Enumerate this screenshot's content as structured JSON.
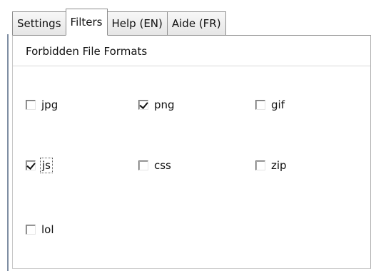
{
  "tabs": [
    {
      "label": "Settings",
      "active": false
    },
    {
      "label": "Filters",
      "active": true
    },
    {
      "label": "Help (EN)",
      "active": false
    },
    {
      "label": "Aide (FR)",
      "active": false
    }
  ],
  "filters": {
    "section_title": "Forbidden File Formats",
    "formats": [
      {
        "label": "jpg",
        "checked": false
      },
      {
        "label": "png",
        "checked": true
      },
      {
        "label": "gif",
        "checked": false
      },
      {
        "label": "js",
        "checked": true,
        "focused": true
      },
      {
        "label": "css",
        "checked": false
      },
      {
        "label": "zip",
        "checked": false
      },
      {
        "label": "lol",
        "checked": false
      }
    ]
  },
  "colors": {
    "tab_border": "#8d8d8d",
    "panel_border": "#d1d1d1",
    "left_rail": "#7f8ea3",
    "checkbox_border": "#6e6e6e"
  },
  "icons": {
    "checked_checkbox": "check-mark",
    "unchecked_checkbox": "empty-checkbox"
  }
}
